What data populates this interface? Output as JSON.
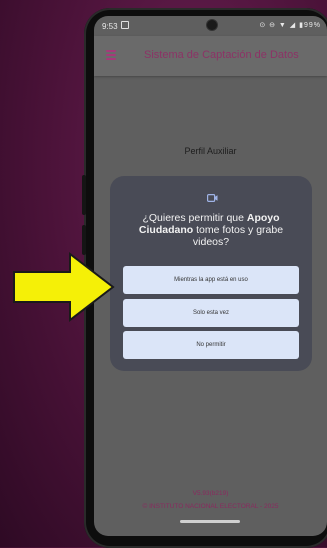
{
  "status_bar": {
    "time": "9:53",
    "icons": "⊙ ⊖ ▼ ◢ ▮99%"
  },
  "app_bar": {
    "title": "Sistema de Captación de Datos"
  },
  "profile_label": "Perfil Auxiliar",
  "dialog": {
    "title_prefix": "¿Quieres permitir que ",
    "app_name": "Apoyo Ciudadano",
    "title_suffix": " tome fotos y grabe videos?",
    "options": [
      "Mientras la app está en uso",
      "Solo esta vez",
      "No permitir"
    ]
  },
  "footer": {
    "version": "V5.93(b219)",
    "copyright": "© INSTITUTO NACIONAL ELECTORAL - 2025"
  },
  "icons": {
    "menu": "menu-icon",
    "dialog": "video-camera-icon",
    "overlay": "arrow-right-icon"
  },
  "colors": {
    "accent": "#8c3366",
    "arrow": "#f5f007",
    "button": "#dbe5f8",
    "dialog": "#494b56"
  }
}
